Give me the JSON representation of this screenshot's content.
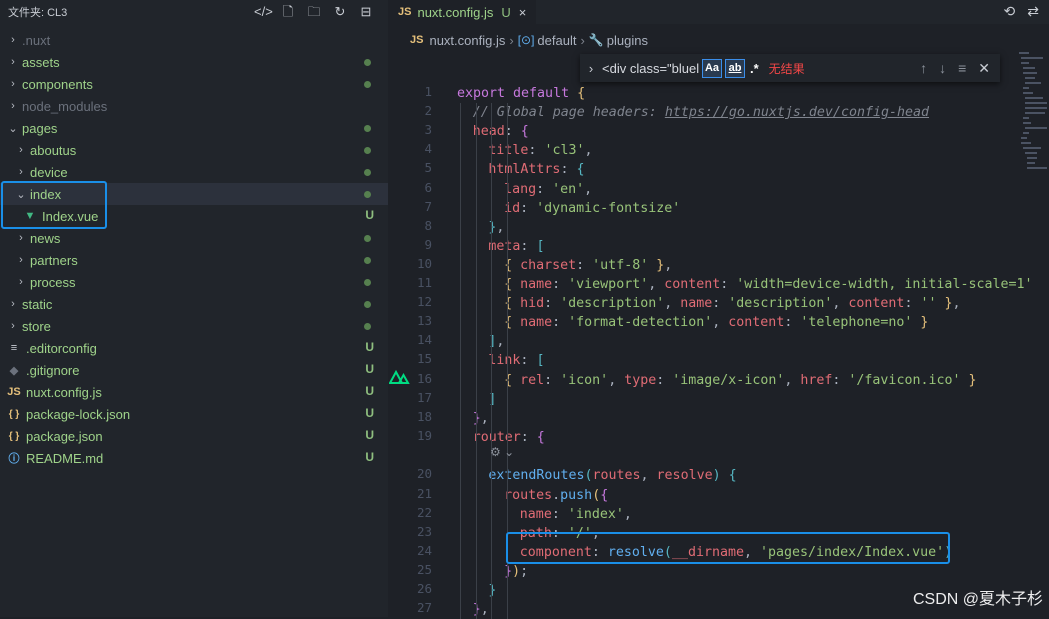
{
  "sidebar": {
    "title": "文件夹: CL3",
    "tree": [
      {
        "name": ".nuxt",
        "kind": "folder",
        "state": "closed",
        "level": 0,
        "style": "dim",
        "status": ""
      },
      {
        "name": "assets",
        "kind": "folder",
        "state": "closed",
        "level": 0,
        "style": "green",
        "status": "dot"
      },
      {
        "name": "components",
        "kind": "folder",
        "state": "closed",
        "level": 0,
        "style": "green",
        "status": "dot"
      },
      {
        "name": "node_modules",
        "kind": "folder",
        "state": "closed",
        "level": 0,
        "style": "dim",
        "status": ""
      },
      {
        "name": "pages",
        "kind": "folder",
        "state": "open",
        "level": 0,
        "style": "green",
        "status": "dot"
      },
      {
        "name": "aboutus",
        "kind": "folder",
        "state": "closed",
        "level": 1,
        "style": "green",
        "status": "dot"
      },
      {
        "name": "device",
        "kind": "folder",
        "state": "closed",
        "level": 1,
        "style": "green",
        "status": "dot"
      },
      {
        "name": "index",
        "kind": "folder",
        "state": "open",
        "level": 1,
        "style": "green",
        "status": "dot",
        "selected": true
      },
      {
        "name": "Index.vue",
        "kind": "vue",
        "level": 2,
        "style": "green",
        "status": "U"
      },
      {
        "name": "news",
        "kind": "folder",
        "state": "closed",
        "level": 1,
        "style": "green",
        "status": "dot"
      },
      {
        "name": "partners",
        "kind": "folder",
        "state": "closed",
        "level": 1,
        "style": "green",
        "status": "dot"
      },
      {
        "name": "process",
        "kind": "folder",
        "state": "closed",
        "level": 1,
        "style": "green",
        "status": "dot"
      },
      {
        "name": "static",
        "kind": "folder",
        "state": "closed",
        "level": 0,
        "style": "green",
        "status": "dot"
      },
      {
        "name": "store",
        "kind": "folder",
        "state": "closed",
        "level": 0,
        "style": "green",
        "status": "dot"
      },
      {
        "name": ".editorconfig",
        "kind": "config",
        "level": 0,
        "style": "green",
        "status": "U"
      },
      {
        "name": ".gitignore",
        "kind": "git",
        "level": 0,
        "style": "green",
        "status": "U"
      },
      {
        "name": "nuxt.config.js",
        "kind": "js",
        "level": 0,
        "style": "green",
        "status": "U"
      },
      {
        "name": "package-lock.json",
        "kind": "json",
        "level": 0,
        "style": "green",
        "status": "U"
      },
      {
        "name": "package.json",
        "kind": "json",
        "level": 0,
        "style": "green",
        "status": "U"
      },
      {
        "name": "README.md",
        "kind": "info",
        "level": 0,
        "style": "green",
        "status": "U"
      }
    ]
  },
  "tab": {
    "icon_text": "JS",
    "label": "nuxt.config.js",
    "status": "U"
  },
  "breadcrumb": {
    "file": "nuxt.config.js",
    "symbol1": "default",
    "symbol2": "plugins"
  },
  "find": {
    "query": "<div class=\"bluel",
    "match_case": "Aa",
    "whole_word": "ab",
    "regex": ".*",
    "result": "无结果"
  },
  "code": {
    "lines": [
      {
        "n": 1,
        "indent": 0,
        "tokens": [
          [
            "kw",
            "export default"
          ],
          [
            "pu",
            " "
          ],
          [
            "bk2",
            "{"
          ]
        ]
      },
      {
        "n": 2,
        "indent": 1,
        "tokens": [
          [
            "cm",
            "// Global page headers: "
          ],
          [
            "cm url",
            "https://go.nuxtjs.dev/config-head"
          ]
        ]
      },
      {
        "n": 3,
        "indent": 1,
        "tokens": [
          [
            "pr",
            "head"
          ],
          [
            "pu",
            ": "
          ],
          [
            "kw",
            "{"
          ]
        ]
      },
      {
        "n": 4,
        "indent": 2,
        "tokens": [
          [
            "pr",
            "title"
          ],
          [
            "pu",
            ": "
          ],
          [
            "st",
            "'cl3'"
          ],
          [
            "pu",
            ","
          ]
        ]
      },
      {
        "n": 5,
        "indent": 2,
        "tokens": [
          [
            "pr",
            "htmlAttrs"
          ],
          [
            "pu",
            ": "
          ],
          [
            "bk",
            "{"
          ]
        ]
      },
      {
        "n": 6,
        "indent": 3,
        "tokens": [
          [
            "pr",
            "lang"
          ],
          [
            "pu",
            ": "
          ],
          [
            "st",
            "'en'"
          ],
          [
            "pu",
            ","
          ]
        ]
      },
      {
        "n": 7,
        "indent": 3,
        "tokens": [
          [
            "pr",
            "id"
          ],
          [
            "pu",
            ": "
          ],
          [
            "st",
            "'dynamic-fontsize'"
          ]
        ]
      },
      {
        "n": 8,
        "indent": 2,
        "tokens": [
          [
            "bk",
            "}"
          ],
          [
            "pu",
            ","
          ]
        ]
      },
      {
        "n": 9,
        "indent": 2,
        "tokens": [
          [
            "pr",
            "meta"
          ],
          [
            "pu",
            ": "
          ],
          [
            "bk",
            "["
          ]
        ]
      },
      {
        "n": 10,
        "indent": 3,
        "tokens": [
          [
            "bk2",
            "{ "
          ],
          [
            "pr",
            "charset"
          ],
          [
            "pu",
            ": "
          ],
          [
            "st",
            "'utf-8'"
          ],
          [
            "bk2",
            " }"
          ],
          [
            "pu",
            ","
          ]
        ]
      },
      {
        "n": 11,
        "indent": 3,
        "tokens": [
          [
            "bk2",
            "{ "
          ],
          [
            "pr",
            "name"
          ],
          [
            "pu",
            ": "
          ],
          [
            "st",
            "'viewport'"
          ],
          [
            "pu",
            ", "
          ],
          [
            "pr",
            "content"
          ],
          [
            "pu",
            ": "
          ],
          [
            "st",
            "'width=device-width, initial-scale=1'"
          ]
        ]
      },
      {
        "n": 12,
        "indent": 3,
        "tokens": [
          [
            "bk2",
            "{ "
          ],
          [
            "pr",
            "hid"
          ],
          [
            "pu",
            ": "
          ],
          [
            "st",
            "'description'"
          ],
          [
            "pu",
            ", "
          ],
          [
            "pr",
            "name"
          ],
          [
            "pu",
            ": "
          ],
          [
            "st",
            "'description'"
          ],
          [
            "pu",
            ", "
          ],
          [
            "pr",
            "content"
          ],
          [
            "pu",
            ": "
          ],
          [
            "st",
            "''"
          ],
          [
            "bk2",
            " }"
          ],
          [
            "pu",
            ","
          ]
        ]
      },
      {
        "n": 13,
        "indent": 3,
        "tokens": [
          [
            "bk2",
            "{ "
          ],
          [
            "pr",
            "name"
          ],
          [
            "pu",
            ": "
          ],
          [
            "st",
            "'format-detection'"
          ],
          [
            "pu",
            ", "
          ],
          [
            "pr",
            "content"
          ],
          [
            "pu",
            ": "
          ],
          [
            "st",
            "'telephone=no'"
          ],
          [
            "bk2",
            " }"
          ]
        ]
      },
      {
        "n": 14,
        "indent": 2,
        "tokens": [
          [
            "bk",
            "]"
          ],
          [
            "pu",
            ","
          ]
        ]
      },
      {
        "n": 15,
        "indent": 2,
        "tokens": [
          [
            "pr",
            "link"
          ],
          [
            "pu",
            ": "
          ],
          [
            "bk",
            "["
          ]
        ]
      },
      {
        "n": 16,
        "indent": 3,
        "tokens": [
          [
            "bk2",
            "{ "
          ],
          [
            "pr",
            "rel"
          ],
          [
            "pu",
            ": "
          ],
          [
            "st",
            "'icon'"
          ],
          [
            "pu",
            ", "
          ],
          [
            "pr",
            "type"
          ],
          [
            "pu",
            ": "
          ],
          [
            "st",
            "'image/x-icon'"
          ],
          [
            "pu",
            ", "
          ],
          [
            "pr",
            "href"
          ],
          [
            "pu",
            ": "
          ],
          [
            "st",
            "'/favicon.ico'"
          ],
          [
            "bk2",
            " }"
          ]
        ]
      },
      {
        "n": 17,
        "indent": 2,
        "tokens": [
          [
            "bk",
            "]"
          ]
        ]
      },
      {
        "n": 18,
        "indent": 1,
        "tokens": [
          [
            "kw",
            "}"
          ],
          [
            "pu",
            ","
          ]
        ]
      },
      {
        "n": 19,
        "indent": 1,
        "tokens": [
          [
            "pr",
            "router"
          ],
          [
            "pu",
            ": "
          ],
          [
            "kw",
            "{"
          ]
        ]
      },
      {
        "n": 20,
        "indent": 2,
        "tokens": [
          [
            "fn",
            "extendRoutes"
          ],
          [
            "bk",
            "("
          ],
          [
            "pr",
            "routes"
          ],
          [
            "pu",
            ", "
          ],
          [
            "pr",
            "resolve"
          ],
          [
            "bk",
            ")"
          ],
          [
            "pu",
            " "
          ],
          [
            "bk",
            "{"
          ]
        ]
      },
      {
        "n": 21,
        "indent": 3,
        "tokens": [
          [
            "pr",
            "routes"
          ],
          [
            "pu",
            "."
          ],
          [
            "fn",
            "push"
          ],
          [
            "bk2",
            "("
          ],
          [
            "kw",
            "{"
          ]
        ]
      },
      {
        "n": 22,
        "indent": 4,
        "tokens": [
          [
            "pr",
            "name"
          ],
          [
            "pu",
            ": "
          ],
          [
            "st",
            "'index'"
          ],
          [
            "pu",
            ","
          ]
        ]
      },
      {
        "n": 23,
        "indent": 4,
        "tokens": [
          [
            "pr",
            "path"
          ],
          [
            "pu",
            ": "
          ],
          [
            "st",
            "'/'"
          ],
          [
            "pu",
            ","
          ]
        ]
      },
      {
        "n": 24,
        "indent": 4,
        "tokens": [
          [
            "pr",
            "component"
          ],
          [
            "pu",
            ": "
          ],
          [
            "fn",
            "resolve"
          ],
          [
            "bk",
            "("
          ],
          [
            "pr",
            "__dirname"
          ],
          [
            "pu",
            ", "
          ],
          [
            "st",
            "'pages/index/Index.vue'"
          ],
          [
            "bk",
            ")"
          ]
        ]
      },
      {
        "n": 25,
        "indent": 3,
        "tokens": [
          [
            "kw",
            "}"
          ],
          [
            "bk2",
            ")"
          ],
          [
            "pu",
            ";"
          ]
        ]
      },
      {
        "n": 26,
        "indent": 2,
        "tokens": [
          [
            "bk",
            "}"
          ]
        ]
      },
      {
        "n": 27,
        "indent": 1,
        "tokens": [
          [
            "kw",
            "}"
          ],
          [
            "pu",
            ","
          ]
        ]
      }
    ]
  },
  "watermark": "CSDN @夏木子杉",
  "colors": {
    "highlight_border": "#1a8fe8",
    "untracked": "#8fbf7f",
    "keyword": "#c678dd",
    "property": "#e06c75",
    "string": "#98c379"
  }
}
